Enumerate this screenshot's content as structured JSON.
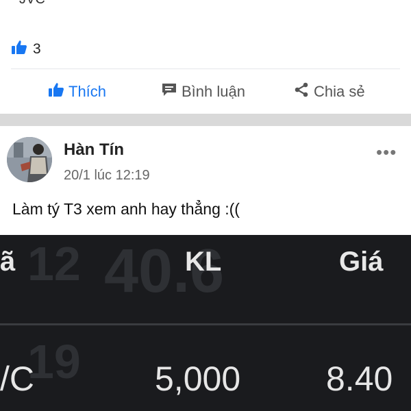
{
  "previous_post": {
    "clipped_text": "JVC",
    "like_count": "3",
    "actions": {
      "like": "Thích",
      "comment": "Bình luận",
      "share": "Chia sẻ"
    }
  },
  "post": {
    "author": "Hàn Tín",
    "timestamp": "20/1 lúc 12:19",
    "text": "Làm tý T3 xem anh hay thẳng :(("
  },
  "screenshot": {
    "headers": [
      "ã",
      "KL",
      "Giá"
    ],
    "row": [
      "/C",
      "5,000",
      "8.40"
    ],
    "background_digits": [
      "12",
      "40.6",
      "19"
    ]
  },
  "colors": {
    "accent": "#1877f2",
    "table_bg": "#1a1b1e",
    "separator": "#d9d9d9"
  }
}
